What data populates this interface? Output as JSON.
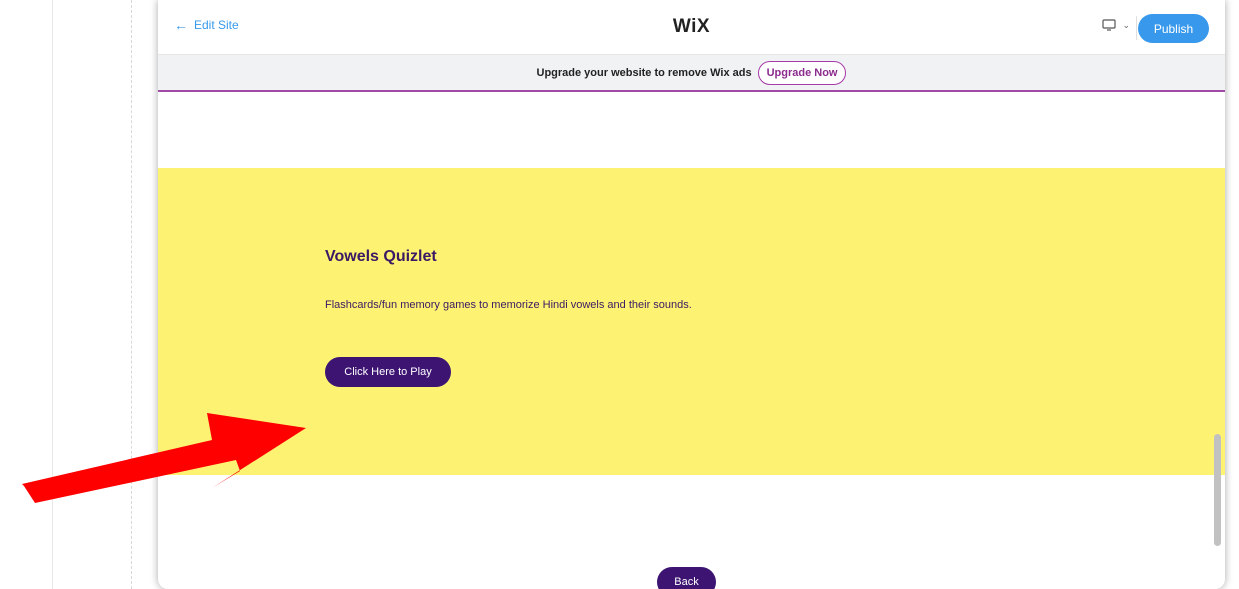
{
  "topbar": {
    "back_label": "Edit Site",
    "logo": "WiX",
    "publish_label": "Publish",
    "device_icon": "desktop-monitor-icon"
  },
  "adbar": {
    "text": "Upgrade your website to remove Wix ads",
    "button_label": "Upgrade Now"
  },
  "section": {
    "title": "Vowels Quizlet",
    "description": "Flashcards/fun memory games to memorize Hindi vowels and their sounds.",
    "play_label": "Click Here to Play"
  },
  "footer": {
    "back_label": "Back"
  },
  "colors": {
    "accent": "#3899ec",
    "yellow": "#fdf272",
    "purple": "#3d1472",
    "annotation_arrow": "#ff0000"
  }
}
